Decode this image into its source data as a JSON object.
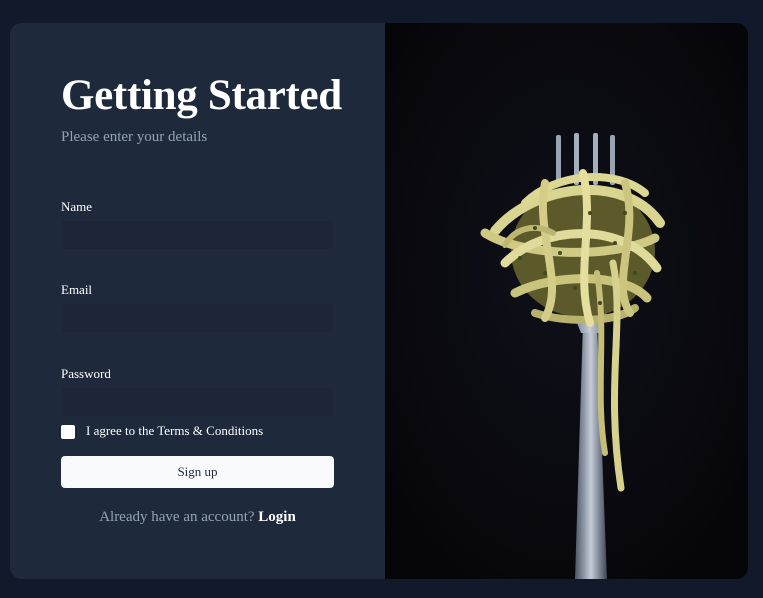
{
  "form": {
    "title": "Getting Started",
    "subtitle": "Please enter your details",
    "name_label": "Name",
    "name_value": "",
    "email_label": "Email",
    "email_value": "",
    "password_label": "Password",
    "password_value": "",
    "terms_label": "I agree to the Terms & Conditions",
    "terms_checked": false,
    "signup_label": "Sign up",
    "login_prompt": "Already have an account?",
    "login_link": "Login"
  },
  "image": {
    "subject": "pasta-on-fork-photo"
  },
  "colors": {
    "page_bg": "#101a2b",
    "card_bg": "#1e293b",
    "photo_bg": "#07070d",
    "text_primary": "#ffffff",
    "text_muted": "#94a3b8",
    "button_bg": "#f8fafc"
  }
}
